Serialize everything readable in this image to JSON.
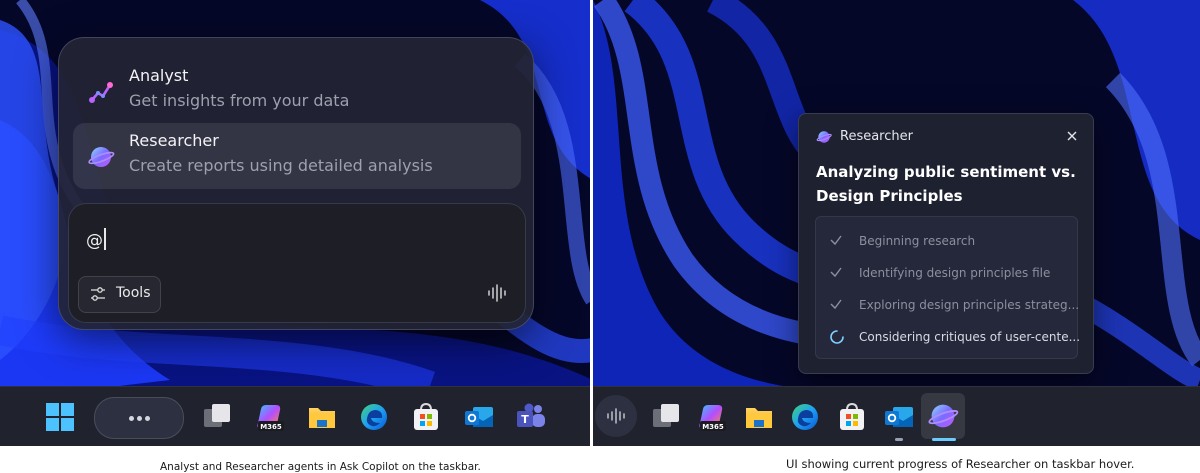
{
  "left_screen": {
    "agents": [
      {
        "icon": "analyst-icon",
        "name": "Analyst",
        "description": "Get insights from your data"
      },
      {
        "icon": "researcher-icon",
        "name": "Researcher",
        "description": "Create reports using detailed analysis",
        "highlighted": true
      }
    ],
    "composer": {
      "input_value": "@",
      "tools_label": "Tools",
      "tools_icon": "sliders-icon",
      "voice_icon": "voice-waveform-icon"
    },
    "taskbar": [
      "windows-start-icon",
      "ask-copilot-search-pill",
      "task-view-icon",
      "m365-copilot-icon",
      "file-explorer-icon",
      "edge-icon",
      "microsoft-store-icon",
      "outlook-icon",
      "teams-icon"
    ],
    "m365_badge": "M365",
    "caption": "Analyst and Researcher agents in Ask Copilot on the taskbar."
  },
  "right_screen": {
    "progress_card": {
      "title": "Researcher",
      "heading": "Analyzing public sentiment vs. Design Principles",
      "steps": [
        {
          "label": "Beginning research",
          "status": "done"
        },
        {
          "label": "Identifying design principles file",
          "status": "done"
        },
        {
          "label": "Exploring design principles strateg...",
          "status": "done"
        },
        {
          "label": "Considering critiques of user-cente...",
          "status": "in-progress"
        }
      ]
    },
    "taskbar": [
      "voice-icon",
      "task-view-icon",
      "m365-copilot-icon",
      "file-explorer-icon",
      "edge-icon",
      "microsoft-store-icon",
      "outlook-icon",
      "researcher-icon"
    ],
    "m365_badge": "M365",
    "caption": "UI showing current progress of Researcher on taskbar hover."
  },
  "colors": {
    "wallpaper_dark": "#06082a",
    "wallpaper_blue": "#1d3cff",
    "accent_purple": "#9a5cff",
    "taskbar": "#20232d"
  }
}
